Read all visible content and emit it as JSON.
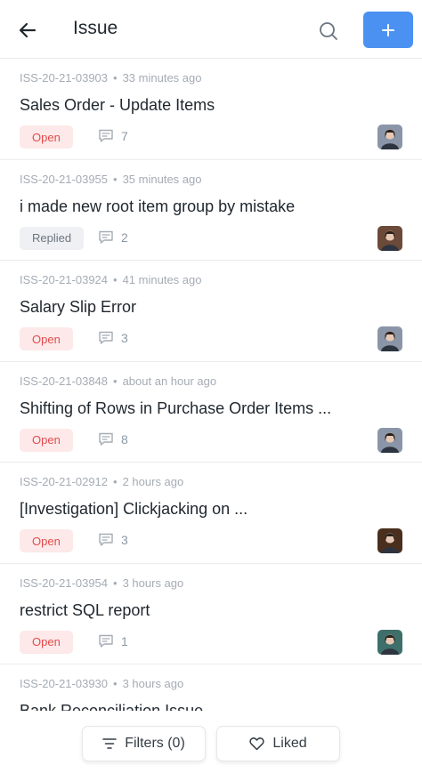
{
  "header": {
    "title": "Issue",
    "back_icon": "arrow-left-icon",
    "search_icon": "search-icon",
    "add_icon": "plus-icon",
    "accent": "#4b91f1"
  },
  "issues": [
    {
      "id": "ISS-20-21-03903",
      "time": "33 minutes ago",
      "subject": "Sales Order - Update Items",
      "status": "Open",
      "comments": "7",
      "avatar_color": "#8a96a8"
    },
    {
      "id": "ISS-20-21-03955",
      "time": "35 minutes ago",
      "subject": "i made new root item group by mistake",
      "status": "Replied",
      "comments": "2",
      "avatar_color": "#6b4a3a"
    },
    {
      "id": "ISS-20-21-03924",
      "time": "41 minutes ago",
      "subject": "Salary Slip Error",
      "status": "Open",
      "comments": "3",
      "avatar_color": "#8a96a8"
    },
    {
      "id": "ISS-20-21-03848",
      "time": "about an hour ago",
      "subject": "Shifting of Rows in Purchase Order Items ...",
      "status": "Open",
      "comments": "8",
      "avatar_color": "#8a96a8"
    },
    {
      "id": "ISS-20-21-02912",
      "time": "2 hours ago",
      "subject": "[Investigation] Clickjacking on ...",
      "status": "Open",
      "comments": "3",
      "avatar_color": "#4a2f1e"
    },
    {
      "id": "ISS-20-21-03954",
      "time": "3 hours ago",
      "subject": "restrict SQL report",
      "status": "Open",
      "comments": "1",
      "avatar_color": "#3f6f6a"
    },
    {
      "id": "ISS-20-21-03930",
      "time": "3 hours ago",
      "subject": "Bank Reconciliation Issue",
      "status": "",
      "comments": "",
      "avatar_color": ""
    }
  ],
  "footer": {
    "filters_label": "Filters (0)",
    "filters_icon": "filter-lines-icon",
    "liked_label": "Liked",
    "liked_icon": "heart-icon"
  },
  "colors": {
    "open_badge_bg": "#fde9e9",
    "open_badge_text": "#e24c4c",
    "replied_badge_bg": "#eef0f3",
    "replied_badge_text": "#6b7580"
  }
}
